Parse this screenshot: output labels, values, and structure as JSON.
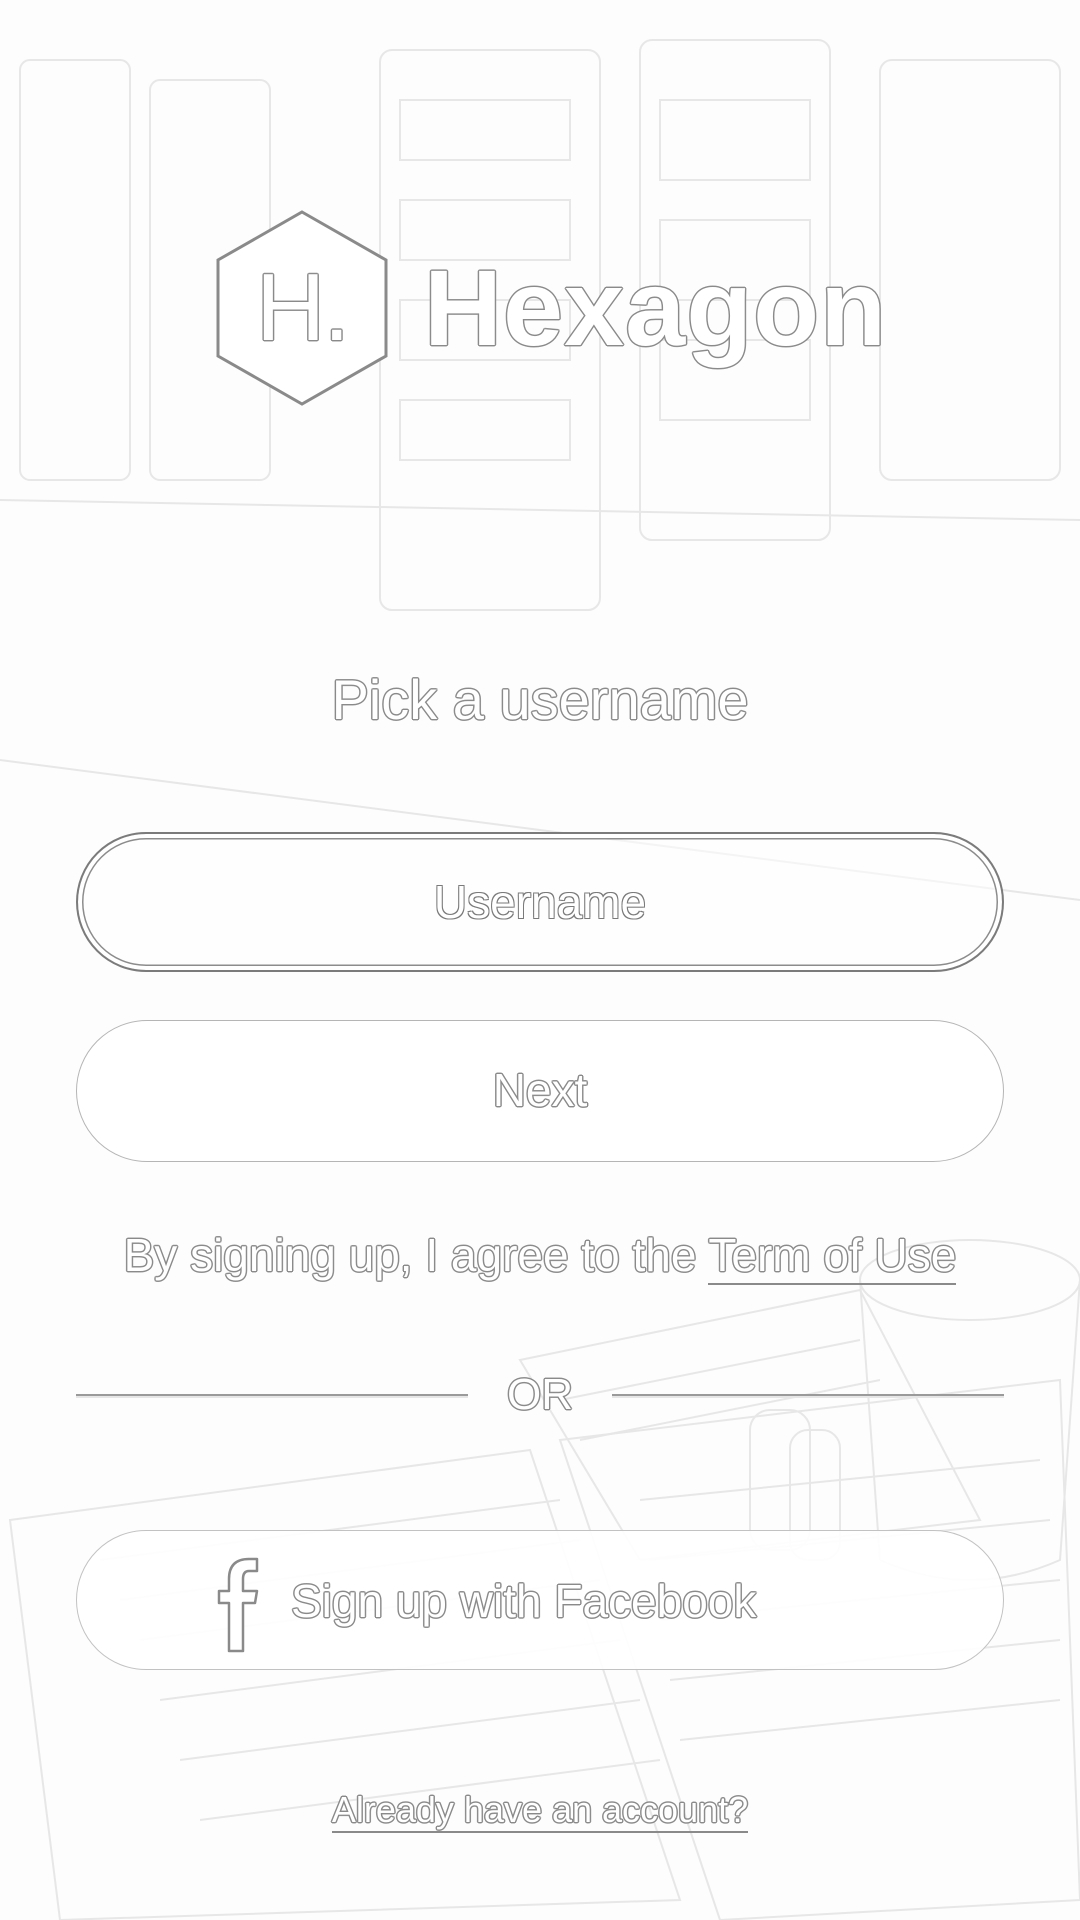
{
  "app": {
    "logo_letter": "H.",
    "name": "Hexagon"
  },
  "signup": {
    "headline": "Pick a username",
    "username_placeholder": "Username",
    "next_label": "Next",
    "terms_prefix": "By signing up, I agree to the ",
    "terms_link": "Term of Use",
    "or_label": "OR",
    "facebook_label": "Sign up with Facebook",
    "login_link": "Already have an account?"
  },
  "icons": {
    "logo": "hexagon-logo-icon",
    "facebook": "facebook-icon"
  },
  "colors": {
    "outline": "#8a8a8a",
    "background": "#fdfdfd"
  }
}
